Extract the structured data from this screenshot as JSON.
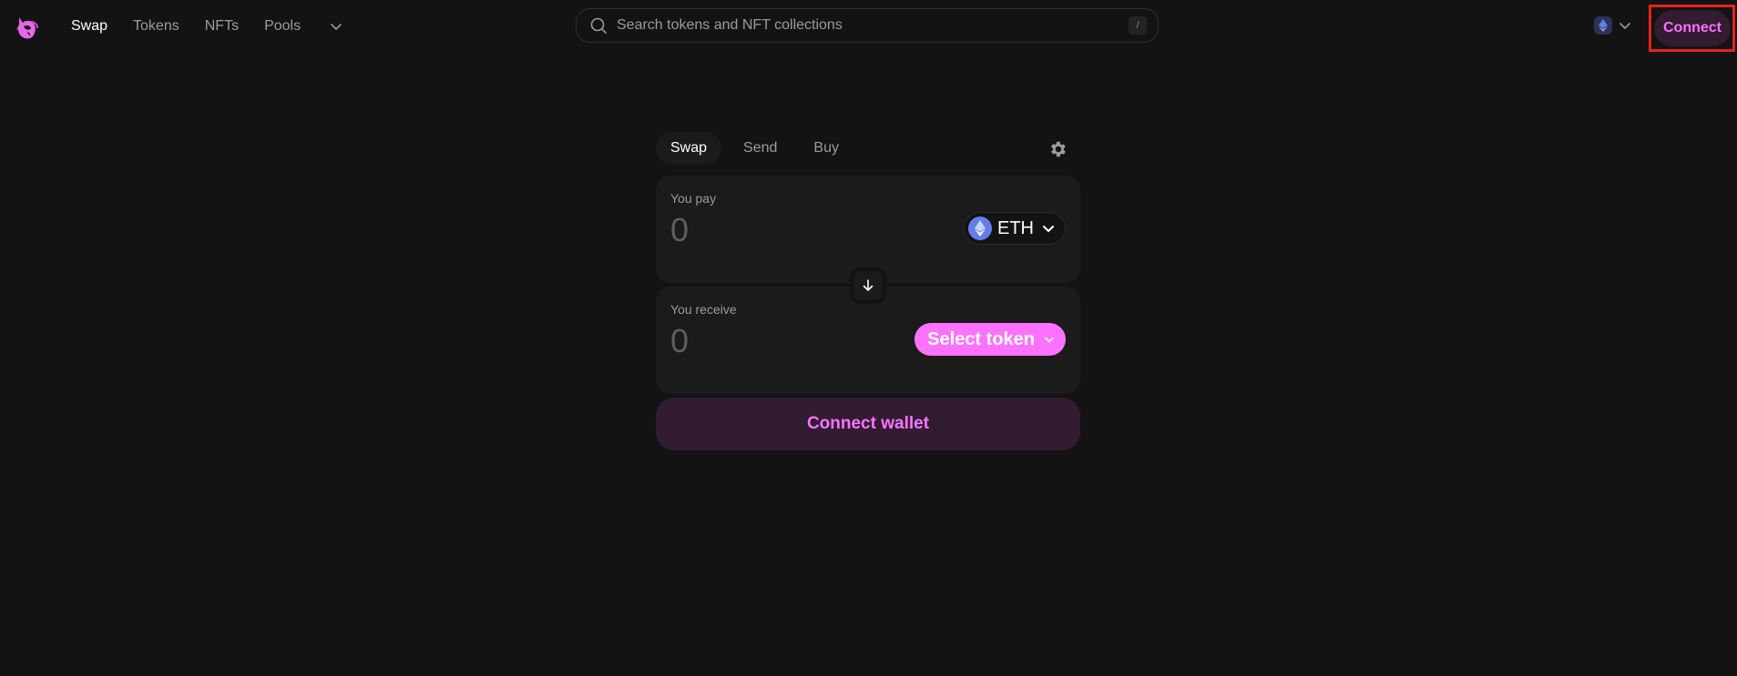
{
  "navbar": {
    "logo": "uniswap-unicorn-logo",
    "links": [
      {
        "label": "Swap",
        "active": true
      },
      {
        "label": "Tokens",
        "active": false
      },
      {
        "label": "NFTs",
        "active": false
      },
      {
        "label": "Pools",
        "active": false
      }
    ],
    "more_icon": "chevron-down-icon",
    "search": {
      "placeholder": "Search tokens and NFT collections",
      "value": "",
      "shortcut": "/"
    },
    "chain": {
      "name": "Ethereum",
      "icon": "ethereum-icon"
    },
    "connect_label": "Connect"
  },
  "swap": {
    "tabs": [
      {
        "label": "Swap",
        "active": true
      },
      {
        "label": "Send",
        "active": false
      },
      {
        "label": "Buy",
        "active": false
      }
    ],
    "settings_icon": "gear-icon",
    "pay": {
      "label": "You pay",
      "amount_placeholder": "0",
      "token": "ETH"
    },
    "receive": {
      "label": "You receive",
      "amount_placeholder": "0",
      "token_button": "Select token"
    },
    "switch_icon": "arrow-down-icon",
    "connect_wallet_label": "Connect wallet"
  },
  "colors": {
    "background": "#131313",
    "surface": "#1b1b1b",
    "accent": "#fc72ff",
    "accent_soft": "#311c31",
    "eth": "#627eea",
    "highlight_box": "#e5231c"
  }
}
